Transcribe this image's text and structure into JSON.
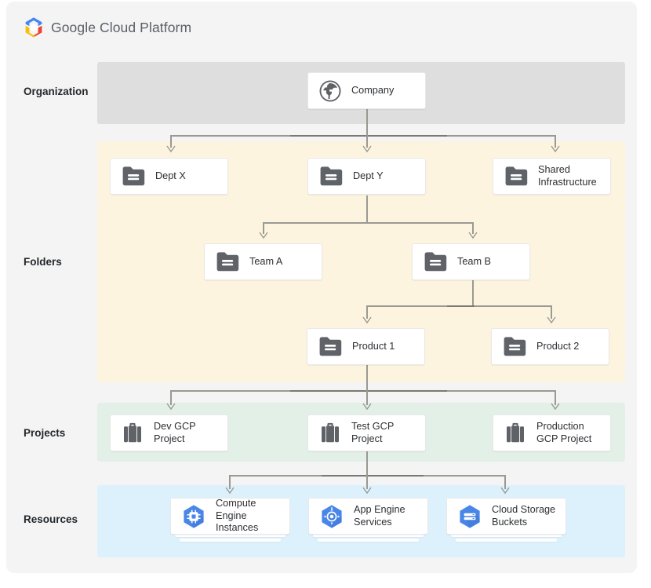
{
  "brand": {
    "logo_icon": "gcp-hexagon-logo",
    "name_bold": "Google",
    "name_rest": " Cloud Platform",
    "colors": {
      "logo_blue": "#4285f4",
      "logo_red": "#ea4335",
      "logo_yellow": "#fbbc05",
      "text": "#5b6066"
    }
  },
  "rows": [
    {
      "id": "organization",
      "label": "Organization",
      "band_color": "#dedede"
    },
    {
      "id": "folders",
      "label": "Folders",
      "band_color": "#fdf4e0"
    },
    {
      "id": "projects",
      "label": "Projects",
      "band_color": "#e2f0e8"
    },
    {
      "id": "resources",
      "label": "Resources",
      "band_color": "#ddf1fd"
    }
  ],
  "nodes": {
    "organization": [
      {
        "id": "company",
        "label": "Company",
        "icon": "globe-icon"
      }
    ],
    "folders_level1": [
      {
        "id": "dept-x",
        "label": "Dept X",
        "icon": "folder-icon"
      },
      {
        "id": "dept-y",
        "label": "Dept Y",
        "icon": "folder-icon"
      },
      {
        "id": "shared-infrastructure",
        "label": "Shared\nInfrastructure",
        "icon": "folder-icon"
      }
    ],
    "folders_level2": [
      {
        "id": "team-a",
        "label": "Team A",
        "icon": "folder-icon"
      },
      {
        "id": "team-b",
        "label": "Team B",
        "icon": "folder-icon"
      }
    ],
    "folders_level3": [
      {
        "id": "product-1",
        "label": "Product 1",
        "icon": "folder-icon"
      },
      {
        "id": "product-2",
        "label": "Product 2",
        "icon": "folder-icon"
      }
    ],
    "projects": [
      {
        "id": "dev-gcp-project",
        "label": "Dev GCP\nProject",
        "icon": "briefcase-icon"
      },
      {
        "id": "test-gcp-project",
        "label": "Test GCP\nProject",
        "icon": "briefcase-icon"
      },
      {
        "id": "production-gcp-project",
        "label": "Production\nGCP Project",
        "icon": "briefcase-icon"
      }
    ],
    "resources": [
      {
        "id": "compute-engine-instances",
        "label": "Compute Engine\nInstances",
        "icon": "compute-engine-icon"
      },
      {
        "id": "app-engine-services",
        "label": "App Engine\nServices",
        "icon": "app-engine-icon"
      },
      {
        "id": "cloud-storage-buckets",
        "label": "Cloud Storage\nBuckets",
        "icon": "cloud-storage-icon"
      }
    ]
  },
  "edges": [
    {
      "from": "company",
      "to": [
        "dept-x",
        "dept-y",
        "shared-infrastructure"
      ]
    },
    {
      "from": "dept-y",
      "to": [
        "team-a",
        "team-b"
      ]
    },
    {
      "from": "team-b",
      "to": [
        "product-1",
        "product-2"
      ]
    },
    {
      "from": "product-1",
      "to": [
        "dev-gcp-project",
        "test-gcp-project",
        "production-gcp-project"
      ]
    },
    {
      "from": "test-gcp-project",
      "to": [
        "compute-engine-instances",
        "app-engine-services",
        "cloud-storage-buckets"
      ]
    }
  ],
  "colors": {
    "connector": "#9a9a93",
    "card_bg": "#ffffff",
    "card_border": "#e8e8e8",
    "resource_icon_blue": "#4a86e8",
    "dark_icon": "#5f6368",
    "panel_bg": "#f4f4f4",
    "page_bg": "#ffffff"
  }
}
